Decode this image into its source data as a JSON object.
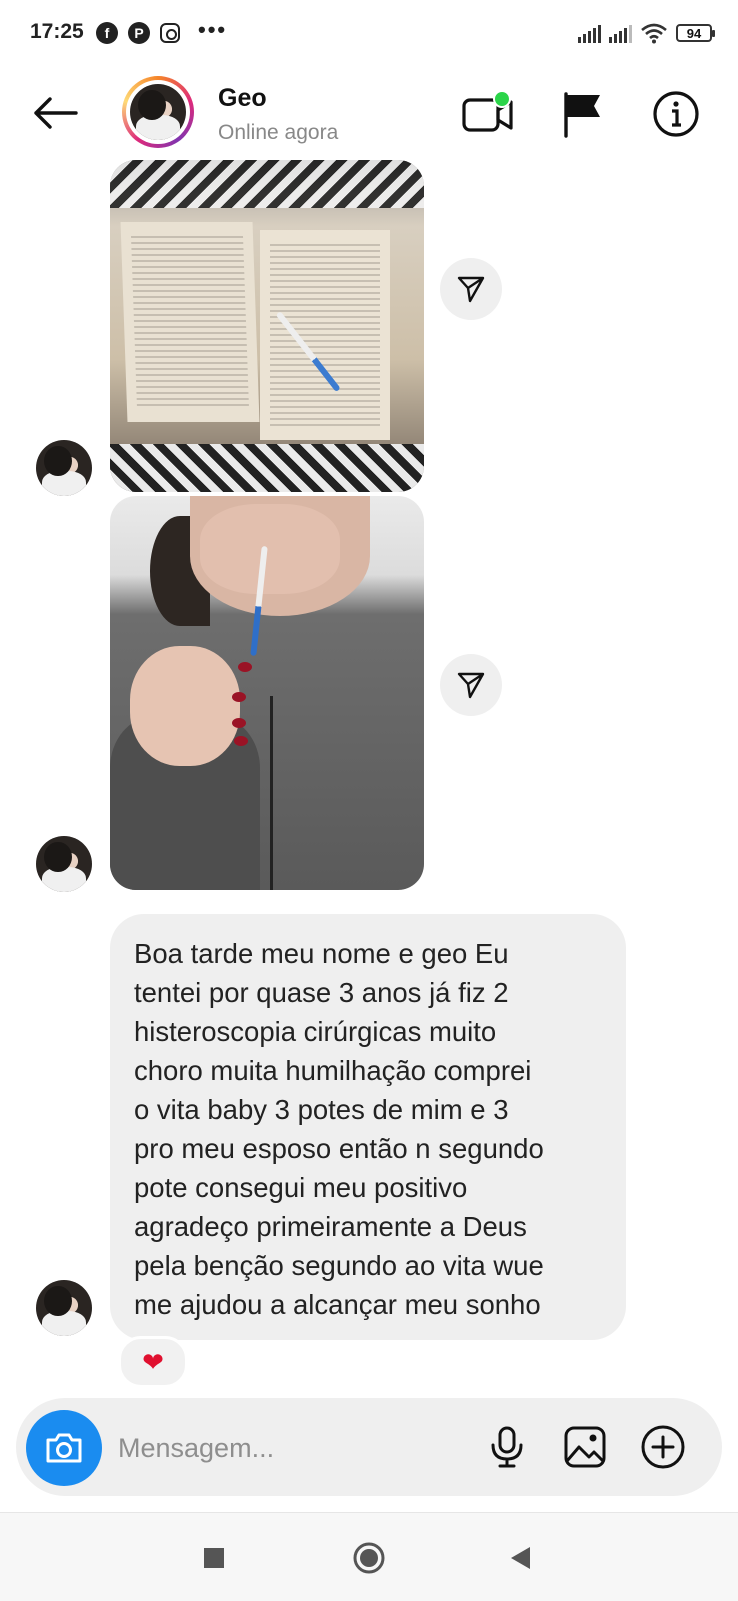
{
  "status_bar": {
    "time": "17:25",
    "left_icons": [
      "facebook-icon",
      "pinterest-icon",
      "instagram-icon"
    ],
    "more": "•••",
    "battery": "94",
    "facebook_glyph": "f",
    "pinterest_glyph": "P"
  },
  "header": {
    "name": "Geo",
    "status": "Online agora",
    "online_dot_color": "#2bd449"
  },
  "messages": {
    "text": "Boa tarde meu nome e geo Eu\ntentei por quase 3 anos já fiz 2\nhisteroscopia cirúrgicas  muito\nchoro muita humilhação comprei\no vita baby 3 potes de mim e 3\npro meu esposo então n segundo\npote consegui meu positivo\nagradeço primeiramente a Deus\npela benção segundo ao vita wue\nme ajudou a alcançar meu sonho",
    "reaction": "❤"
  },
  "composer": {
    "placeholder": "Mensagem..."
  },
  "colors": {
    "accent_blue": "#1a8cf0",
    "bubble_bg": "#efefef",
    "reaction_red": "#e0102f"
  }
}
